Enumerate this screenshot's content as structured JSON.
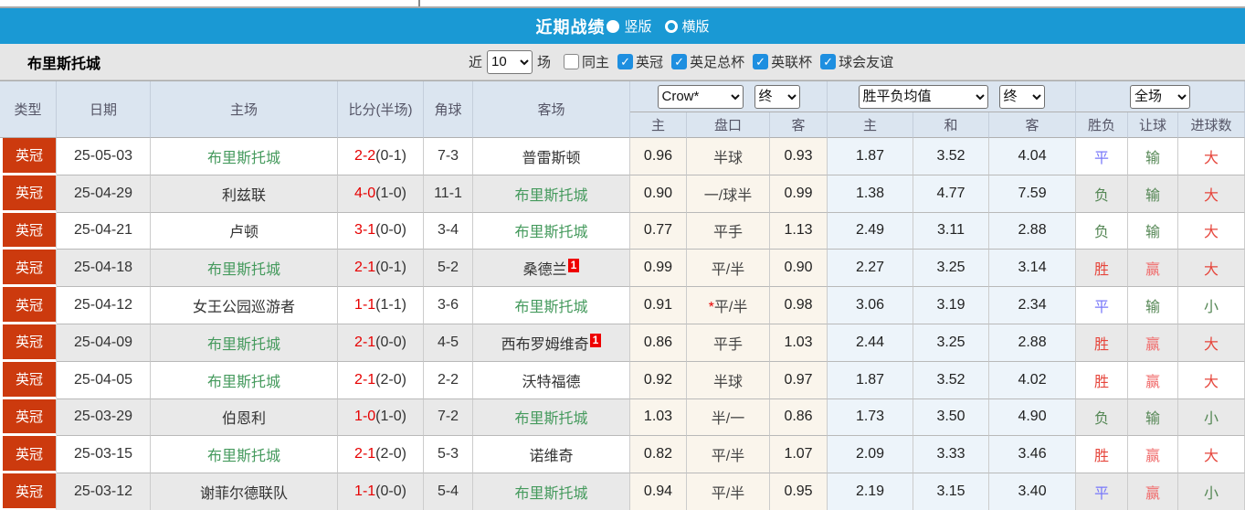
{
  "colors": {
    "header_blue": "#1a99d4",
    "checkbox_blue": "#1e8fe0",
    "league_badge_red": "#cc3a0e",
    "focus_team_green": "#459a5d",
    "score_red": "#e60000",
    "win_red": "#e6463c",
    "draw_blue": "#7878fa",
    "lose_green": "#558755",
    "odds_cell_cream": "#faf5ec",
    "avg_cell_blue": "#edf4fa"
  },
  "title_bar": {
    "title": "近期战绩",
    "layout_options": [
      {
        "label": "竖版",
        "selected": true
      },
      {
        "label": "横版",
        "selected": false
      }
    ]
  },
  "filter_bar": {
    "team_name": "布里斯托城",
    "recent_prefix": "近",
    "match_count": "10",
    "matches_suffix": "场",
    "checkboxes": [
      {
        "label": "同主",
        "checked": false
      },
      {
        "label": "英冠",
        "checked": true
      },
      {
        "label": "英足总杯",
        "checked": true
      },
      {
        "label": "英联杯",
        "checked": true
      },
      {
        "label": "球会友谊",
        "checked": true
      }
    ]
  },
  "table": {
    "column_headers": {
      "type": "类型",
      "date": "日期",
      "home": "主场",
      "score": "比分(半场)",
      "corners": "角球",
      "away": "客场",
      "odds_home": "主",
      "odds_line": "盘口",
      "odds_away": "客",
      "avg_home": "主",
      "avg_draw": "和",
      "avg_away": "客",
      "result": "胜负",
      "handicap": "让球",
      "goals": "进球数"
    },
    "selects": {
      "odds_source": "Crow*",
      "odds_time": "终",
      "avg_source": "胜平负均值",
      "avg_time": "终",
      "scope": "全场"
    },
    "rows": [
      {
        "league": "英冠",
        "date": "25-05-03",
        "home": "布里斯托城",
        "home_is_focus": true,
        "score_ft": "2-2",
        "score_ht": "(0-1)",
        "corners": "7-3",
        "away": "普雷斯顿",
        "away_is_focus": false,
        "odds_home": "0.96",
        "line": "半球",
        "odds_away": "0.93",
        "avg_home": "1.87",
        "avg_draw": "3.52",
        "avg_away": "4.04",
        "result": "平",
        "result_type": "draw",
        "handicap": "输",
        "handicap_type": "lose",
        "goals": "大",
        "goals_type": "big"
      },
      {
        "league": "英冠",
        "date": "25-04-29",
        "home": "利兹联",
        "home_is_focus": false,
        "score_ft": "4-0",
        "score_ht": "(1-0)",
        "corners": "11-1",
        "away": "布里斯托城",
        "away_is_focus": true,
        "odds_home": "0.90",
        "line": "一/球半",
        "odds_away": "0.99",
        "avg_home": "1.38",
        "avg_draw": "4.77",
        "avg_away": "7.59",
        "result": "负",
        "result_type": "lose",
        "handicap": "输",
        "handicap_type": "lose",
        "goals": "大",
        "goals_type": "big"
      },
      {
        "league": "英冠",
        "date": "25-04-21",
        "home": "卢顿",
        "home_is_focus": false,
        "score_ft": "3-1",
        "score_ht": "(0-0)",
        "corners": "3-4",
        "away": "布里斯托城",
        "away_is_focus": true,
        "odds_home": "0.77",
        "line": "平手",
        "odds_away": "1.13",
        "avg_home": "2.49",
        "avg_draw": "3.11",
        "avg_away": "2.88",
        "result": "负",
        "result_type": "lose",
        "handicap": "输",
        "handicap_type": "lose",
        "goals": "大",
        "goals_type": "big"
      },
      {
        "league": "英冠",
        "date": "25-04-18",
        "home": "布里斯托城",
        "home_is_focus": true,
        "score_ft": "2-1",
        "score_ht": "(0-1)",
        "corners": "5-2",
        "away": "桑德兰",
        "away_is_focus": false,
        "away_badge": "1",
        "odds_home": "0.99",
        "line": "平/半",
        "odds_away": "0.90",
        "avg_home": "2.27",
        "avg_draw": "3.25",
        "avg_away": "3.14",
        "result": "胜",
        "result_type": "win",
        "handicap": "赢",
        "handicap_type": "win",
        "goals": "大",
        "goals_type": "big"
      },
      {
        "league": "英冠",
        "date": "25-04-12",
        "home": "女王公园巡游者",
        "home_is_focus": false,
        "score_ft": "1-1",
        "score_ht": "(1-1)",
        "corners": "3-6",
        "away": "布里斯托城",
        "away_is_focus": true,
        "odds_home": "0.91",
        "line_star": "*",
        "line": "平/半",
        "odds_away": "0.98",
        "avg_home": "3.06",
        "avg_draw": "3.19",
        "avg_away": "2.34",
        "result": "平",
        "result_type": "draw",
        "handicap": "输",
        "handicap_type": "lose",
        "goals": "小",
        "goals_type": "small"
      },
      {
        "league": "英冠",
        "date": "25-04-09",
        "home": "布里斯托城",
        "home_is_focus": true,
        "score_ft": "2-1",
        "score_ht": "(0-0)",
        "corners": "4-5",
        "away": "西布罗姆维奇",
        "away_is_focus": false,
        "away_badge": "1",
        "odds_home": "0.86",
        "line": "平手",
        "odds_away": "1.03",
        "avg_home": "2.44",
        "avg_draw": "3.25",
        "avg_away": "2.88",
        "result": "胜",
        "result_type": "win",
        "handicap": "赢",
        "handicap_type": "win",
        "goals": "大",
        "goals_type": "big"
      },
      {
        "league": "英冠",
        "date": "25-04-05",
        "home": "布里斯托城",
        "home_is_focus": true,
        "score_ft": "2-1",
        "score_ht": "(2-0)",
        "corners": "2-2",
        "away": "沃特福德",
        "away_is_focus": false,
        "odds_home": "0.92",
        "line": "半球",
        "odds_away": "0.97",
        "avg_home": "1.87",
        "avg_draw": "3.52",
        "avg_away": "4.02",
        "result": "胜",
        "result_type": "win",
        "handicap": "赢",
        "handicap_type": "win",
        "goals": "大",
        "goals_type": "big"
      },
      {
        "league": "英冠",
        "date": "25-03-29",
        "home": "伯恩利",
        "home_is_focus": false,
        "score_ft": "1-0",
        "score_ht": "(1-0)",
        "corners": "7-2",
        "away": "布里斯托城",
        "away_is_focus": true,
        "odds_home": "1.03",
        "line": "半/一",
        "odds_away": "0.86",
        "avg_home": "1.73",
        "avg_draw": "3.50",
        "avg_away": "4.90",
        "result": "负",
        "result_type": "lose",
        "handicap": "输",
        "handicap_type": "lose",
        "goals": "小",
        "goals_type": "small"
      },
      {
        "league": "英冠",
        "date": "25-03-15",
        "home": "布里斯托城",
        "home_is_focus": true,
        "score_ft": "2-1",
        "score_ht": "(2-0)",
        "corners": "5-3",
        "away": "诺维奇",
        "away_is_focus": false,
        "odds_home": "0.82",
        "line": "平/半",
        "odds_away": "1.07",
        "avg_home": "2.09",
        "avg_draw": "3.33",
        "avg_away": "3.46",
        "result": "胜",
        "result_type": "win",
        "handicap": "赢",
        "handicap_type": "win",
        "goals": "大",
        "goals_type": "big"
      },
      {
        "league": "英冠",
        "date": "25-03-12",
        "home": "谢菲尔德联队",
        "home_is_focus": false,
        "score_ft": "1-1",
        "score_ht": "(0-0)",
        "corners": "5-4",
        "away": "布里斯托城",
        "away_is_focus": true,
        "odds_home": "0.94",
        "line": "平/半",
        "odds_away": "0.95",
        "avg_home": "2.19",
        "avg_draw": "3.15",
        "avg_away": "3.40",
        "result": "平",
        "result_type": "draw",
        "handicap": "赢",
        "handicap_type": "win",
        "goals": "小",
        "goals_type": "small"
      }
    ]
  }
}
